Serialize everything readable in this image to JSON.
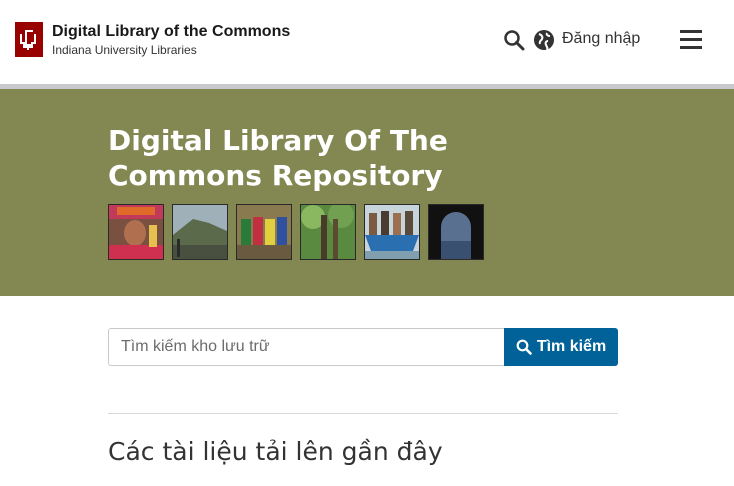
{
  "header": {
    "site_title": "Digital Library of the Commons",
    "site_subtitle": "Indiana University Libraries",
    "login_label": "Đăng nhập",
    "icons": [
      "iu-logo-icon",
      "search-icon",
      "globe-icon",
      "menu-icon"
    ]
  },
  "banner": {
    "title": "Digital Library Of The Commons Repository",
    "background_color": "#838751",
    "thumbnails": [
      "portrait-colorful-hat",
      "coastal-cliff-landscape",
      "group-of-people",
      "forest-trees",
      "people-on-boat",
      "arched-window-view"
    ]
  },
  "search": {
    "placeholder": "Tìm kiếm kho lưu trữ",
    "button_label": "Tìm kiếm",
    "button_color": "#006298"
  },
  "recent": {
    "heading": "Các tài liệu tải lên gần đây"
  }
}
